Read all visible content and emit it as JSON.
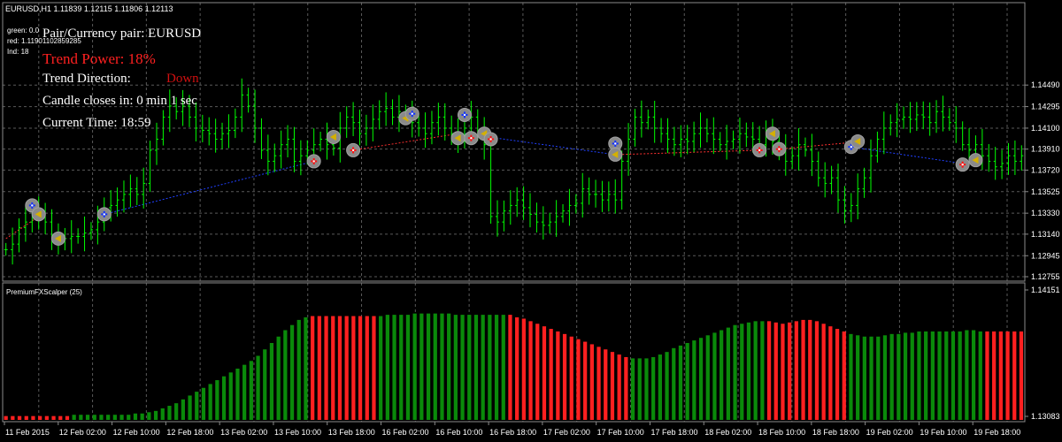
{
  "header": {
    "symbol_info": "EURUSD,H1  1.11839 1.12115 1.11806 1.12113",
    "green": "green: 0.0",
    "red": "red: 1.11901102859285",
    "ind": "Ind: 18"
  },
  "panel": {
    "pair": "Pair/Currency pair: EURUSD",
    "trend_power": "Trend Power: 18%",
    "trend_direction_label": "Trend Direction:",
    "trend_direction_value": "Down",
    "candle_closes": "Candle closes in: 0 min 1 sec",
    "current_time": "Current Time: 18:59"
  },
  "indicator": {
    "name": "PremiumFXScalper (25)"
  },
  "colors": {
    "background": "#000000",
    "grid": "#5a5a5a",
    "candle": "#00ff00",
    "bar_green": "#0a8a0a",
    "bar_red": "#ff2020",
    "info_text": "#ffffff",
    "trend_power": "#ff2020",
    "trend_down": "#d01010",
    "line_red": "#ff3030",
    "line_blue": "#2040ff"
  },
  "chart_data": [
    {
      "type": "candlestick",
      "symbol": "EURUSD",
      "timeframe": "H1",
      "ylim": [
        1.12755,
        1.151
      ],
      "y_ticks": [
        "1.14490",
        "1.14295",
        "1.14100",
        "1.13910",
        "1.13720",
        "1.13525",
        "1.13330",
        "1.13140",
        "1.12945",
        "1.12755"
      ],
      "x_labels": [
        "11 Feb 2015",
        "12 Feb 02:00",
        "12 Feb 10:00",
        "12 Feb 18:00",
        "13 Feb 02:00",
        "13 Feb 10:00",
        "13 Feb 18:00",
        "16 Feb 02:00",
        "16 Feb 10:00",
        "16 Feb 18:00",
        "17 Feb 02:00",
        "17 Feb 10:00",
        "17 Feb 18:00",
        "18 Feb 02:00",
        "18 Feb 10:00",
        "18 Feb 18:00",
        "19 Feb 02:00",
        "19 Feb 10:00",
        "19 Feb 18:00"
      ],
      "close": [
        1.13,
        1.1305,
        1.132,
        1.1325,
        1.1335,
        1.133,
        1.1325,
        1.131,
        1.1308,
        1.131,
        1.1312,
        1.1312,
        1.1315,
        1.1318,
        1.1325,
        1.1338,
        1.134,
        1.1345,
        1.135,
        1.1355,
        1.135,
        1.136,
        1.139,
        1.14,
        1.142,
        1.143,
        1.1425,
        1.143,
        1.142,
        1.141,
        1.1408,
        1.1405,
        1.14,
        1.1405,
        1.1408,
        1.142,
        1.144,
        1.143,
        1.141,
        1.139,
        1.138,
        1.1385,
        1.1395,
        1.14,
        1.138,
        1.1385,
        1.139,
        1.1395,
        1.14,
        1.1395,
        1.1392,
        1.141,
        1.142,
        1.1415,
        1.1405,
        1.141,
        1.1418,
        1.1425,
        1.1428,
        1.142,
        1.1425,
        1.142,
        1.1415,
        1.141,
        1.1405,
        1.1415,
        1.142,
        1.141,
        1.1405,
        1.14,
        1.141,
        1.142,
        1.1405,
        1.1395,
        1.133,
        1.1325,
        1.1335,
        1.134,
        1.1345,
        1.1338,
        1.1332,
        1.1325,
        1.1322,
        1.1325,
        1.133,
        1.1335,
        1.134,
        1.1342,
        1.1355,
        1.135,
        1.135,
        1.1345,
        1.135,
        1.1345,
        1.138,
        1.14,
        1.142,
        1.1415,
        1.142,
        1.141,
        1.1405,
        1.14,
        1.1395,
        1.14,
        1.1398,
        1.1405,
        1.141,
        1.1405,
        1.14,
        1.1395,
        1.1398,
        1.14,
        1.1405,
        1.1402,
        1.14,
        1.1395,
        1.1405,
        1.1398,
        1.139,
        1.138,
        1.1385,
        1.1395,
        1.139,
        1.138,
        1.1365,
        1.136,
        1.1365,
        1.1345,
        1.1335,
        1.134,
        1.1355,
        1.1365,
        1.1385,
        1.14,
        1.141,
        1.1415,
        1.1418,
        1.142,
        1.1418,
        1.1422,
        1.142,
        1.1415,
        1.1425,
        1.142,
        1.1415,
        1.141,
        1.1395,
        1.139,
        1.1395,
        1.1385,
        1.138,
        1.1375,
        1.1378,
        1.1385,
        1.138,
        1.1385
      ],
      "signals": [
        {
          "index": 4,
          "price": 1.134,
          "kind": "buy"
        },
        {
          "index": 5,
          "price": 1.1332,
          "kind": "exit"
        },
        {
          "index": 8,
          "price": 1.131,
          "kind": "exit"
        },
        {
          "index": 15,
          "price": 1.1332,
          "kind": "buy"
        },
        {
          "index": 47,
          "price": 1.138,
          "kind": "sell"
        },
        {
          "index": 50,
          "price": 1.1402,
          "kind": "exit"
        },
        {
          "index": 53,
          "price": 1.139,
          "kind": "sell"
        },
        {
          "index": 61,
          "price": 1.1419,
          "kind": "exit"
        },
        {
          "index": 62,
          "price": 1.1423,
          "kind": "buy"
        },
        {
          "index": 69,
          "price": 1.1401,
          "kind": "exit"
        },
        {
          "index": 70,
          "price": 1.1422,
          "kind": "buy"
        },
        {
          "index": 71,
          "price": 1.1401,
          "kind": "sell"
        },
        {
          "index": 73,
          "price": 1.1405,
          "kind": "exit"
        },
        {
          "index": 74,
          "price": 1.14,
          "kind": "sell"
        },
        {
          "index": 93,
          "price": 1.1396,
          "kind": "buy"
        },
        {
          "index": 93,
          "price": 1.1386,
          "kind": "exit"
        },
        {
          "index": 115,
          "price": 1.139,
          "kind": "sell"
        },
        {
          "index": 117,
          "price": 1.1405,
          "kind": "exit"
        },
        {
          "index": 118,
          "price": 1.1391,
          "kind": "sell"
        },
        {
          "index": 129,
          "price": 1.1393,
          "kind": "buy"
        },
        {
          "index": 130,
          "price": 1.1398,
          "kind": "exit"
        },
        {
          "index": 146,
          "price": 1.1377,
          "kind": "sell"
        },
        {
          "index": 148,
          "price": 1.1381,
          "kind": "exit"
        }
      ],
      "lines": [
        {
          "color": "red",
          "points": [
            [
              0,
              1.131
            ],
            [
              5,
              1.133
            ]
          ]
        },
        {
          "color": "blue",
          "points": [
            [
              15,
              1.1332
            ],
            [
              47,
              1.138
            ]
          ]
        },
        {
          "color": "red",
          "points": [
            [
              53,
              1.139
            ],
            [
              69,
              1.1405
            ]
          ]
        },
        {
          "color": "blue",
          "points": [
            [
              70,
              1.1405
            ],
            [
              93,
              1.1386
            ]
          ]
        },
        {
          "color": "red",
          "points": [
            [
              93,
              1.1386
            ],
            [
              115,
              1.139
            ]
          ]
        },
        {
          "color": "red",
          "points": [
            [
              118,
              1.1391
            ],
            [
              129,
              1.1397
            ]
          ]
        },
        {
          "color": "blue",
          "points": [
            [
              129,
              1.1393
            ],
            [
              146,
              1.1378
            ]
          ]
        }
      ]
    },
    {
      "type": "bar",
      "name": "PremiumFXScalper (25)",
      "ylim": [
        1.13083,
        1.14151
      ],
      "y_ticks": [
        "1.14151",
        "1.13083"
      ],
      "values": [
        0.03,
        0.03,
        0.03,
        0.03,
        0.03,
        0.03,
        0.03,
        0.03,
        0.03,
        0.03,
        0.04,
        0.04,
        0.04,
        0.04,
        0.04,
        0.04,
        0.04,
        0.04,
        0.04,
        0.05,
        0.05,
        0.06,
        0.07,
        0.09,
        0.11,
        0.13,
        0.16,
        0.19,
        0.22,
        0.25,
        0.28,
        0.31,
        0.34,
        0.37,
        0.4,
        0.43,
        0.46,
        0.5,
        0.55,
        0.6,
        0.65,
        0.7,
        0.74,
        0.78,
        0.8,
        0.81,
        0.81,
        0.81,
        0.81,
        0.81,
        0.81,
        0.81,
        0.81,
        0.81,
        0.81,
        0.81,
        0.82,
        0.82,
        0.82,
        0.82,
        0.83,
        0.83,
        0.83,
        0.83,
        0.83,
        0.83,
        0.82,
        0.82,
        0.82,
        0.82,
        0.82,
        0.82,
        0.82,
        0.82,
        0.82,
        0.8,
        0.79,
        0.77,
        0.75,
        0.73,
        0.71,
        0.69,
        0.67,
        0.65,
        0.63,
        0.61,
        0.59,
        0.57,
        0.55,
        0.53,
        0.51,
        0.49,
        0.48,
        0.48,
        0.48,
        0.49,
        0.51,
        0.53,
        0.56,
        0.58,
        0.6,
        0.62,
        0.64,
        0.66,
        0.68,
        0.7,
        0.72,
        0.74,
        0.75,
        0.76,
        0.77,
        0.77,
        0.77,
        0.76,
        0.75,
        0.76,
        0.77,
        0.78,
        0.78,
        0.77,
        0.75,
        0.73,
        0.71,
        0.69,
        0.67,
        0.66,
        0.65,
        0.65,
        0.65,
        0.66,
        0.67,
        0.67,
        0.68,
        0.68,
        0.69,
        0.69,
        0.69,
        0.69,
        0.69,
        0.69,
        0.69,
        0.7,
        0.7,
        0.69,
        0.69,
        0.69,
        0.69,
        0.69,
        0.69,
        0.69
      ],
      "colors": [
        "red",
        "red",
        "red",
        "red",
        "red",
        "red",
        "red",
        "red",
        "red",
        "red",
        "green",
        "green",
        "green",
        "green",
        "green",
        "green",
        "green",
        "green",
        "green",
        "green",
        "green",
        "green",
        "green",
        "green",
        "green",
        "green",
        "green",
        "green",
        "green",
        "green",
        "green",
        "green",
        "green",
        "green",
        "green",
        "green",
        "green",
        "green",
        "green",
        "green",
        "green",
        "green",
        "green",
        "green",
        "green",
        "red",
        "red",
        "red",
        "red",
        "red",
        "red",
        "red",
        "red",
        "red",
        "red",
        "green",
        "green",
        "green",
        "green",
        "green",
        "green",
        "green",
        "green",
        "green",
        "green",
        "green",
        "green",
        "green",
        "green",
        "green",
        "green",
        "green",
        "green",
        "green",
        "red",
        "red",
        "red",
        "red",
        "red",
        "red",
        "red",
        "red",
        "red",
        "red",
        "red",
        "red",
        "red",
        "red",
        "red",
        "red",
        "red",
        "red",
        "green",
        "green",
        "green",
        "green",
        "green",
        "green",
        "green",
        "green",
        "green",
        "green",
        "green",
        "green",
        "green",
        "green",
        "green",
        "green",
        "green",
        "green",
        "green",
        "green",
        "red",
        "red",
        "red",
        "red",
        "red",
        "red",
        "red",
        "red",
        "red",
        "red",
        "red",
        "red",
        "green",
        "green",
        "green",
        "green",
        "green",
        "green",
        "green",
        "green",
        "green",
        "green",
        "green",
        "green",
        "green",
        "green",
        "green",
        "green",
        "green",
        "green",
        "green",
        "green",
        "red",
        "red",
        "red",
        "red",
        "red",
        "red",
        "red",
        "red",
        "red"
      ]
    }
  ]
}
